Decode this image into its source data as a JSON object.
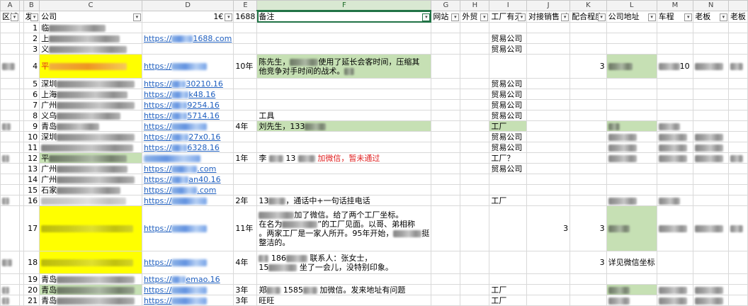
{
  "columns": [
    "A",
    "B",
    "C",
    "D",
    "E",
    "F",
    "G",
    "H",
    "I",
    "J",
    "K",
    "L",
    "M",
    "N",
    ""
  ],
  "filters": {
    "a": "区域",
    "b": "发",
    "c": "公司",
    "d": "1€",
    "e": "1688",
    "f": "备注",
    "g": "网站",
    "h": "外贸",
    "i": "工厂有无",
    "j": "对接销售（",
    "k": "配合程度",
    "l": "公司地址",
    "m": "车程",
    "n": "老板",
    "o": "老板"
  },
  "rows": [
    {
      "n": "2",
      "b": "1",
      "c": "临",
      "e": "",
      "f": "",
      "i": ""
    },
    {
      "n": "3",
      "b": "2",
      "c": "上",
      "d_link": "https://",
      "d_tail": "1688.com",
      "e": "",
      "f": "",
      "i": "贸易公司"
    },
    {
      "n": "4",
      "b": "3",
      "c": "义",
      "d_link": "",
      "e": "",
      "f": "",
      "i": "贸易公司"
    },
    {
      "n": "5",
      "b": "4",
      "c": "平",
      "d_link": "https://",
      "e": "10年",
      "f1": "陈先生，",
      "f2": "使用了延长会客时间，压缩其",
      "f3": "他竞争对手时间的战术。",
      "l_num": "3",
      "m": "10"
    },
    {
      "n": "6",
      "b": "5",
      "c": "深圳",
      "d_link": "https://",
      "d_tail": "30210.16",
      "i": "贸易公司"
    },
    {
      "n": "7",
      "b": "6",
      "c": "上海",
      "d_link": "https://",
      "d_tail": "k48.16",
      "i": "贸易公司"
    },
    {
      "n": "8",
      "b": "7",
      "c": "广州",
      "d_link": "https://",
      "d_tail": "9254.16",
      "i": "贸易公司"
    },
    {
      "n": "9",
      "b": "8",
      "c": "义乌",
      "d_link": "https://",
      "d_tail": "5714.16",
      "f": "工具",
      "i": "贸易公司"
    },
    {
      "n": "10",
      "b": "9",
      "c": "青岛",
      "d_link": "https://",
      "e": "4年",
      "f": "刘先生，133",
      "i": "工厂"
    },
    {
      "n": "11",
      "b": "10",
      "c": "深圳",
      "d_link": "https://",
      "d_tail": "27x0.16",
      "i": "贸易公司"
    },
    {
      "n": "12",
      "b": "11",
      "c": "",
      "d_link": "https://",
      "d_tail": "6328.16",
      "i": "贸易公司"
    },
    {
      "n": "13",
      "b": "12",
      "c": "平",
      "d_link": "",
      "e": "1年",
      "f_pre": "李",
      "f_num": "13",
      "f_red": "加微信，暂未通过",
      "i": "工厂？"
    },
    {
      "n": "14",
      "b": "13",
      "c": "广州",
      "d_link": "https://",
      "d_tail": ".com",
      "i": "贸易公司"
    },
    {
      "n": "15",
      "b": "14",
      "c": "广州",
      "d_link": "https://",
      "d_tail": "an40.16"
    },
    {
      "n": "16",
      "b": "15",
      "c": "石家",
      "d_link": "https://",
      "d_tail": ".com"
    },
    {
      "n": "17",
      "b": "16",
      "c": "",
      "d_link": "https://",
      "e": "2年",
      "f": "13",
      "f_tail": "，通话中+一句话挂电话",
      "i": "工厂"
    },
    {
      "n": "18",
      "b": "17",
      "c": "",
      "d_link": "https://",
      "e": "11年",
      "f1": "",
      "f1b": "加了微信。给了两个工厂坐标。",
      "f2": "在名为",
      "f2b": "”的工厂见面。以哥、弟相称",
      "f3": "。两家工厂是一家人所开。95年开始，",
      "f3b": "挺",
      "f4": "整洁的。",
      "j": "3",
      "l_num": "3"
    },
    {
      "n": "19",
      "b": "18",
      "c": "",
      "d_link": "https://",
      "e": "4年",
      "f1": "186",
      "f1b": "联系人：张女士，",
      "f2": "15",
      "f2b": "坐了一会儿，没特别印象。",
      "l_num": "3",
      "l": "详见微信坐标"
    },
    {
      "n": "20",
      "b": "19",
      "c": "青岛",
      "d_link": "https://",
      "d_tail": "emao.16"
    },
    {
      "n": "21",
      "b": "20",
      "c": "青岛",
      "d_link": "https://",
      "e": "3年",
      "f": "郑",
      "f_num": "1585",
      "f_tail": "加微信。发来地址有问题",
      "i": "工厂"
    },
    {
      "n": "22",
      "b": "21",
      "c": "青岛",
      "d_link": "https://",
      "e": "3年",
      "f": "旺旺",
      "i": "工厂"
    }
  ]
}
